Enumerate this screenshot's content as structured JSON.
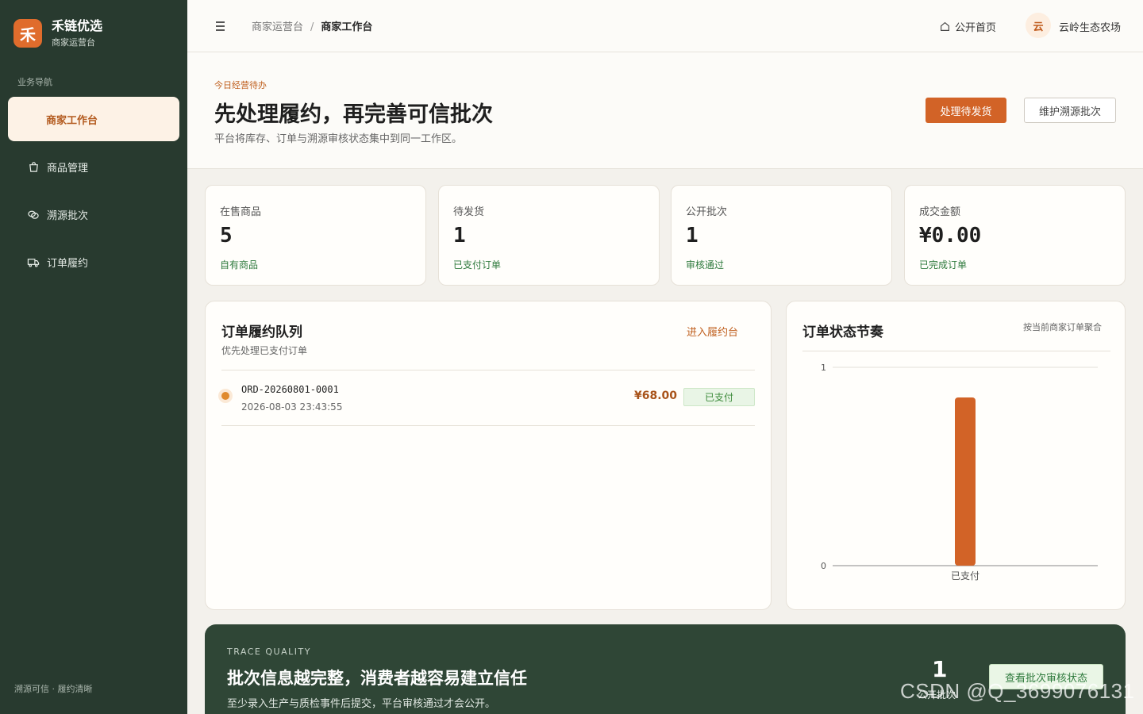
{
  "brand": {
    "logo_char": "禾",
    "name": "禾链优选",
    "subtitle": "商家运营台"
  },
  "sidebar": {
    "heading": "业务导航",
    "items": [
      {
        "label": "商家工作台",
        "icon": "workbench",
        "active": true
      },
      {
        "label": "商品管理",
        "icon": "shopping-bag-icon"
      },
      {
        "label": "溯源批次",
        "icon": "trace-link-icon"
      },
      {
        "label": "订单履约",
        "icon": "truck-icon"
      }
    ],
    "footer": "溯源可信 · 履约清晰"
  },
  "topbar": {
    "breadcrumb": [
      "商家运营台",
      "商家工作台"
    ],
    "breadcrumb_sep": "/",
    "home_link": "公开首页",
    "user_avatar": "云",
    "user_name": "云岭生态农场"
  },
  "hero": {
    "eyebrow": "今日经营待办",
    "title": "先处理履约，再完善可信批次",
    "description": "平台将库存、订单与溯源审核状态集中到同一工作区。",
    "primary_button": "处理待发货",
    "secondary_button": "维护溯源批次"
  },
  "stats": [
    {
      "label": "在售商品",
      "value": "5",
      "note": "自有商品"
    },
    {
      "label": "待发货",
      "value": "1",
      "note": "已支付订单"
    },
    {
      "label": "公开批次",
      "value": "1",
      "note": "审核通过"
    },
    {
      "label": "成交金额",
      "value": "¥0.00",
      "note": "已完成订单"
    }
  ],
  "queue": {
    "title": "订单履约队列",
    "subtitle": "优先处理已支付订单",
    "link": "进入履约台",
    "orders": [
      {
        "id": "ORD-20260801-0001",
        "time": "2026-08-03 23:43:55",
        "amount": "¥68.00",
        "status": "已支付"
      }
    ]
  },
  "rhythm": {
    "title": "订单状态节奏",
    "note": "按当前商家订单聚合"
  },
  "chart_data": {
    "type": "bar",
    "categories": [
      "已支付"
    ],
    "values": [
      1
    ],
    "ylim": [
      0,
      1
    ],
    "yticks": [
      "0",
      "1"
    ],
    "bar_color": "#d26327"
  },
  "trace": {
    "eyebrow": "TRACE QUALITY",
    "title": "批次信息越完整，消费者越容易建立信任",
    "description": "至少录入生产与质检事件后提交，平台审核通过才会公开。",
    "count": "1",
    "count_label": "公开批次",
    "button": "查看批次审核状态"
  },
  "watermark": "CSDN @Q_3699076131",
  "colors": {
    "accent": "#d26327",
    "sidebar": "#283a2f",
    "success": "#2f7a3d"
  }
}
